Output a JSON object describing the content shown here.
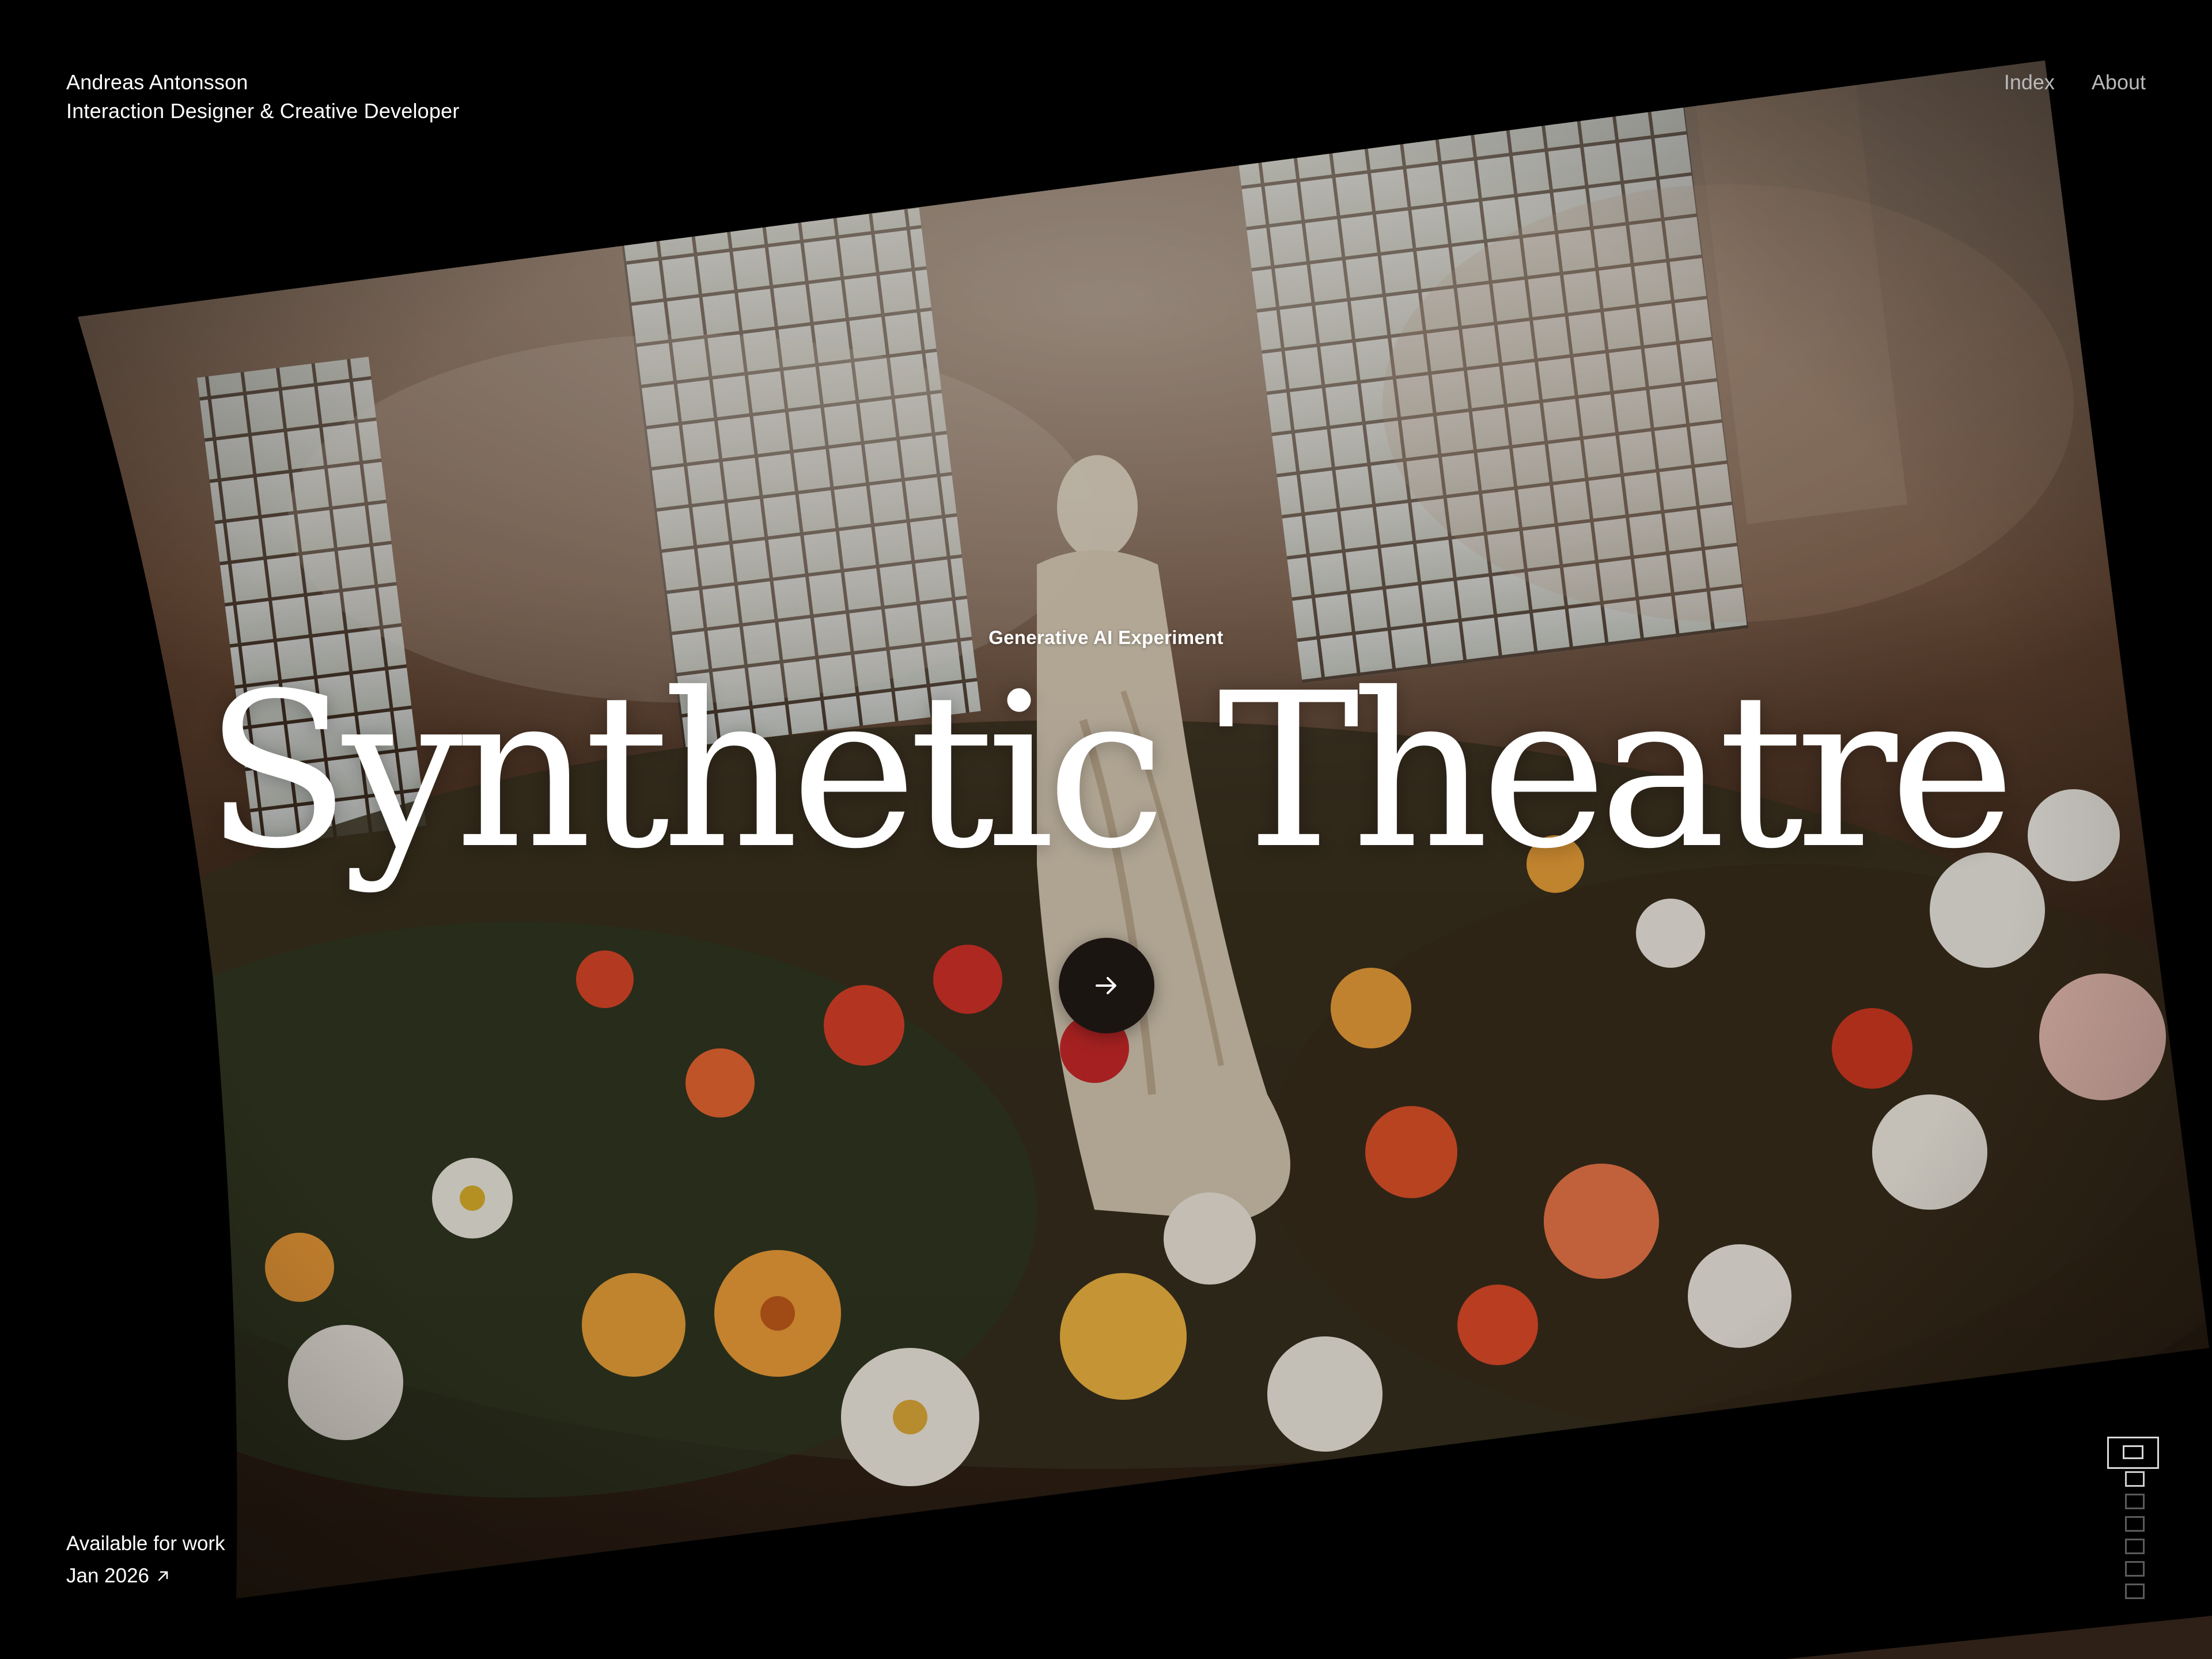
{
  "header": {
    "name": "Andreas Antonsson",
    "role": "Interaction Designer & Creative Developer",
    "nav": [
      {
        "label": "Index"
      },
      {
        "label": "About"
      }
    ]
  },
  "hero": {
    "eyebrow": "Generative AI Experiment",
    "title": "Synthetic Theatre",
    "cta_icon": "arrow-right-icon",
    "image_description_icon": "greenhouse-photo"
  },
  "footer": {
    "availability": "Available for work",
    "date": "Jan 2026",
    "date_icon": "arrow-up-right-icon"
  },
  "pager": {
    "count": 7,
    "current": 1
  },
  "colors": {
    "background": "#000000",
    "text": "#ffffff",
    "nav_text": "#b9b9b9",
    "cta_bg": "#1b1512"
  }
}
